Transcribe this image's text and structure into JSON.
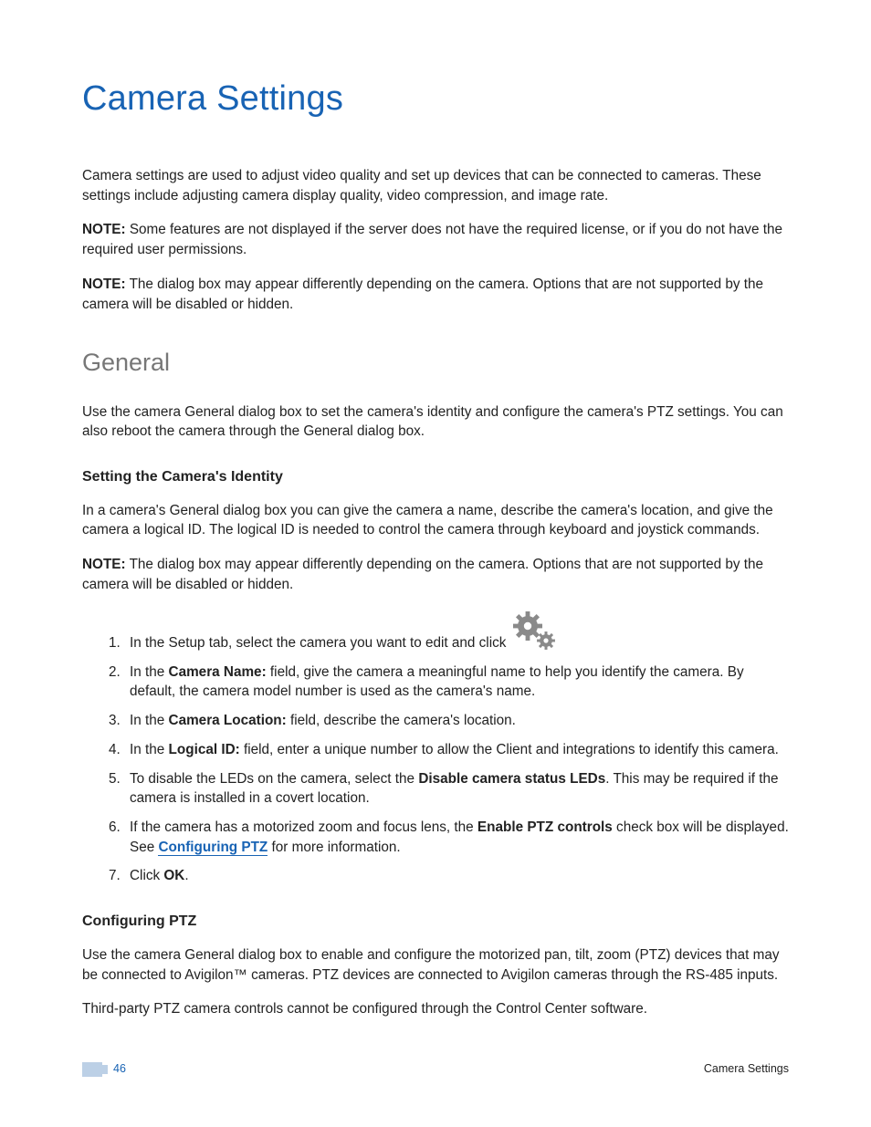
{
  "title": "Camera Settings",
  "intro": "Camera settings are used to adjust video quality and set up devices that can be connected to cameras. These settings include adjusting camera display quality, video compression, and image rate.",
  "note_label": "NOTE:",
  "note1": " Some features are not displayed if the server does not have the required license, or if you do not have the required user permissions.",
  "note2": " The dialog box may appear differently depending on the camera. Options that are not supported by the camera will be disabled or hidden.",
  "general": {
    "heading": "General",
    "intro": "Use the camera General dialog box to set the camera's identity and configure the camera's PTZ settings. You can also reboot the camera through the General dialog box.",
    "identity": {
      "heading": "Setting the Camera's Identity",
      "p1": "In a camera's General dialog box you can give the camera a name, describe the camera's location, and give the camera a logical ID. The logical ID is needed to control the camera through keyboard and joystick commands.",
      "note": " The dialog box may appear differently depending on the camera. Options that are not supported by the camera will be disabled or hidden.",
      "steps": {
        "s1": "In the Setup tab, select the camera you want to edit and click",
        "s2a": "In the ",
        "s2_bold": "Camera Name:",
        "s2b": " field, give the camera a meaningful name to help you identify the camera. By default, the camera model number is used as the camera's name.",
        "s3a": "In the ",
        "s3_bold": "Camera Location:",
        "s3b": " field, describe the camera's location.",
        "s4a": "In the ",
        "s4_bold": "Logical ID:",
        "s4b": " field, enter a unique number to allow the Client and integrations to identify this camera.",
        "s5a": "To disable the LEDs on the camera, select the ",
        "s5_bold": "Disable camera status LEDs",
        "s5b": ". This may be required if the camera is installed in a covert location.",
        "s6a": "If the camera has a motorized zoom and focus lens, the ",
        "s6_bold": "Enable PTZ controls",
        "s6b": " check box will be displayed. See ",
        "s6_link": "Configuring PTZ",
        "s6c": " for more information.",
        "s7a": "Click ",
        "s7_bold": "OK",
        "s7b": "."
      }
    },
    "ptz": {
      "heading": "Configuring PTZ",
      "p1": "Use the camera General dialog box to enable and configure the motorized pan, tilt, zoom (PTZ) devices that may be connected to Avigilon™ cameras.  PTZ devices are connected to Avigilon cameras through the RS-485 inputs.",
      "p2": "Third-party PTZ camera controls cannot be configured through the Control Center software."
    }
  },
  "footer": {
    "page_number": "46",
    "section_label": "Camera Settings"
  }
}
